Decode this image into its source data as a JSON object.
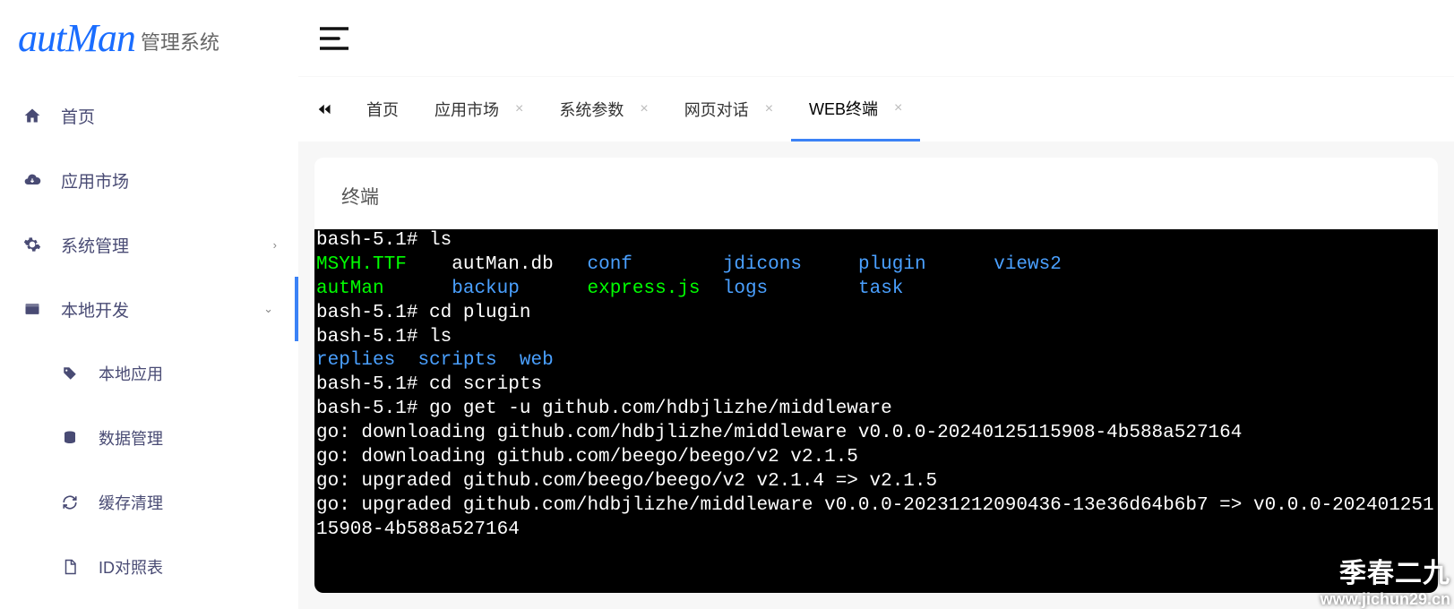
{
  "brand": {
    "logo": "autMan",
    "subtitle": "管理系统"
  },
  "sidebar": {
    "items": [
      {
        "id": "home",
        "label": "首页",
        "icon": "home-icon"
      },
      {
        "id": "market",
        "label": "应用市场",
        "icon": "cloud-down-icon"
      },
      {
        "id": "system",
        "label": "系统管理",
        "icon": "gear-icon",
        "chevron": "›"
      },
      {
        "id": "localdev",
        "label": "本地开发",
        "icon": "box-icon",
        "chevron": "⌄",
        "active": true
      }
    ],
    "subitems": [
      {
        "id": "localapp",
        "label": "本地应用",
        "icon": "tags-icon"
      },
      {
        "id": "datamgr",
        "label": "数据管理",
        "icon": "database-icon"
      },
      {
        "id": "cacheclear",
        "label": "缓存清理",
        "icon": "refresh-icon"
      },
      {
        "id": "idtable",
        "label": "ID对照表",
        "icon": "file-icon"
      }
    ]
  },
  "tabs": [
    {
      "id": "home",
      "label": "首页",
      "closable": false
    },
    {
      "id": "market",
      "label": "应用市场",
      "closable": true
    },
    {
      "id": "sysparam",
      "label": "系统参数",
      "closable": true
    },
    {
      "id": "webchat",
      "label": "网页对话",
      "closable": true
    },
    {
      "id": "webterm",
      "label": "WEB终端",
      "closable": true,
      "active": true
    }
  ],
  "panel": {
    "title": "终端"
  },
  "terminal": {
    "lines": [
      [
        {
          "t": "bash-5.1# ls",
          "c": "w"
        }
      ],
      [
        {
          "t": "MSYH.TTF",
          "c": "g"
        },
        {
          "t": "    ",
          "c": "w"
        },
        {
          "t": "autMan.db   ",
          "c": "w"
        },
        {
          "t": "conf",
          "c": "b"
        },
        {
          "t": "        ",
          "c": "w"
        },
        {
          "t": "jdicons",
          "c": "b"
        },
        {
          "t": "     ",
          "c": "w"
        },
        {
          "t": "plugin",
          "c": "b"
        },
        {
          "t": "      ",
          "c": "w"
        },
        {
          "t": "views2",
          "c": "b"
        }
      ],
      [
        {
          "t": "autMan",
          "c": "g"
        },
        {
          "t": "      ",
          "c": "w"
        },
        {
          "t": "backup",
          "c": "b"
        },
        {
          "t": "      ",
          "c": "w"
        },
        {
          "t": "express.js",
          "c": "g"
        },
        {
          "t": "  ",
          "c": "w"
        },
        {
          "t": "logs",
          "c": "b"
        },
        {
          "t": "        ",
          "c": "w"
        },
        {
          "t": "task",
          "c": "b"
        }
      ],
      [
        {
          "t": "bash-5.1# cd plugin",
          "c": "w"
        }
      ],
      [
        {
          "t": "bash-5.1# ls",
          "c": "w"
        }
      ],
      [
        {
          "t": "replies",
          "c": "b"
        },
        {
          "t": "  ",
          "c": "w"
        },
        {
          "t": "scripts",
          "c": "b"
        },
        {
          "t": "  ",
          "c": "w"
        },
        {
          "t": "web",
          "c": "b"
        }
      ],
      [
        {
          "t": "bash-5.1# cd scripts",
          "c": "w"
        }
      ],
      [
        {
          "t": "bash-5.1# go get -u github.com/hdbjlizhe/middleware",
          "c": "w"
        }
      ],
      [
        {
          "t": "go: downloading github.com/hdbjlizhe/middleware v0.0.0-20240125115908-4b588a527164",
          "c": "w"
        }
      ],
      [
        {
          "t": "go: downloading github.com/beego/beego/v2 v2.1.5",
          "c": "w"
        }
      ],
      [
        {
          "t": "go: upgraded github.com/beego/beego/v2 v2.1.4 => v2.1.5",
          "c": "w"
        }
      ],
      [
        {
          "t": "go: upgraded github.com/hdbjlizhe/middleware v0.0.0-20231212090436-13e36d64b6b7 => v0.0.0-20240125115908-4b588a527164",
          "c": "w"
        }
      ]
    ]
  },
  "watermark": {
    "line1": "季春二九",
    "line2": "www.jichun29.cn"
  },
  "close_glyph": "×"
}
